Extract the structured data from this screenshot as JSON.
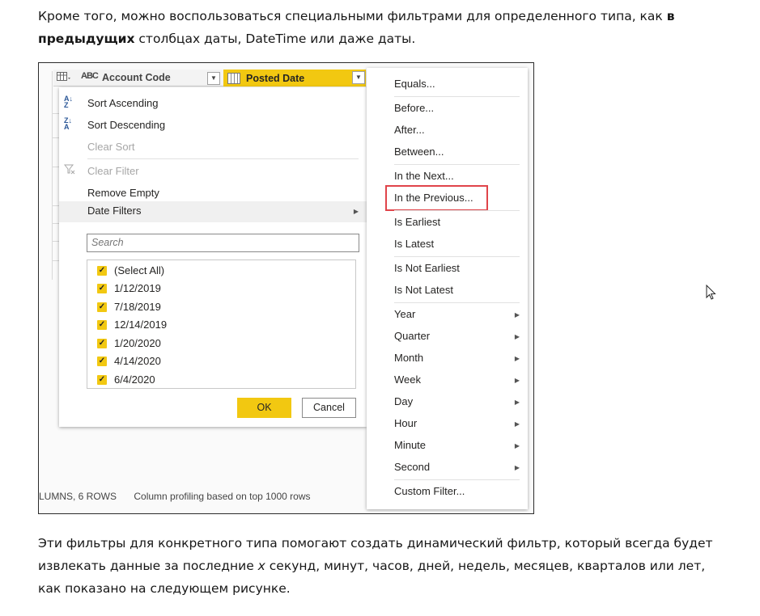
{
  "intro": {
    "part1": "Кроме того, можно воспользоваться специальными фильтрами для определенного типа, как ",
    "bold": "в предыдущих",
    "part2": " столбцах даты, DateTime или даже даты."
  },
  "outro": {
    "part1": "Эти фильтры для конкретного типа помогают создать динамический фильтр, который всегда будет извлекать данные за последние ",
    "italic": "x",
    "part2": " секунд, минут, часов, дней, недель, месяцев, кварталов или лет, как показано на следующем рисунке."
  },
  "header": {
    "account_col": "Account Code",
    "abc_type": "ABC",
    "posted_col": "Posted Date"
  },
  "column_menu": {
    "sort_ascending": "Sort Ascending",
    "sort_descending": "Sort Descending",
    "clear_sort": "Clear Sort",
    "clear_filter": "Clear Filter",
    "remove_empty": "Remove Empty",
    "date_filters": "Date Filters",
    "search_placeholder": "Search",
    "values": [
      "(Select All)",
      "1/12/2019",
      "7/18/2019",
      "12/14/2019",
      "1/20/2020",
      "4/14/2020",
      "6/4/2020"
    ],
    "ok": "OK",
    "cancel": "Cancel"
  },
  "status_bar": {
    "left": "LUMNS, 6 ROWS",
    "profiling": "Column profiling based on top 1000 rows"
  },
  "date_filters_menu": {
    "equals": "Equals...",
    "before": "Before...",
    "after": "After...",
    "between": "Between...",
    "in_the_next": "In the Next...",
    "in_the_previous": "In the Previous...",
    "is_earliest": "Is Earliest",
    "is_latest": "Is Latest",
    "is_not_earliest": "Is Not Earliest",
    "is_not_latest": "Is Not Latest",
    "year": "Year",
    "quarter": "Quarter",
    "month": "Month",
    "week": "Week",
    "day": "Day",
    "hour": "Hour",
    "minute": "Minute",
    "second": "Second",
    "custom_filter": "Custom Filter..."
  },
  "colors": {
    "accent": "#f2c811",
    "highlight_border": "#e0444a"
  }
}
